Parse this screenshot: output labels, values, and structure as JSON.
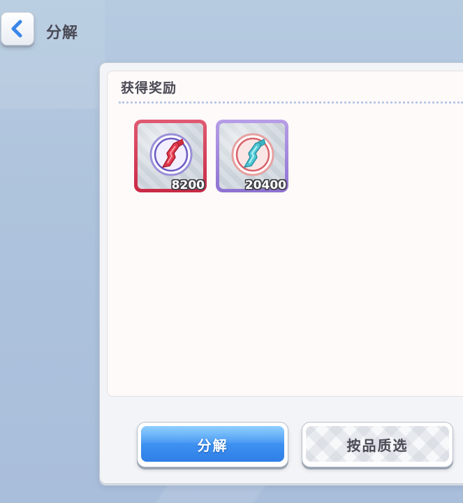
{
  "header": {
    "title": "分解",
    "back_icon": "chevron-left-icon"
  },
  "rewards_panel": {
    "title": "获得奖励",
    "items": [
      {
        "name": "red-rarity-memory-fragment",
        "count": "8200",
        "frame_color": "#c92944"
      },
      {
        "name": "purple-rarity-memory-fragment",
        "count": "20400",
        "frame_color": "#8e72d2"
      }
    ]
  },
  "buttons": {
    "decompose_label": "分解",
    "filter_by_rarity_label": "按品质选"
  },
  "colors": {
    "accent_blue": "#3d8ff0",
    "text_dark": "#4a4a55",
    "divider_dots": "#b9c7e6"
  }
}
